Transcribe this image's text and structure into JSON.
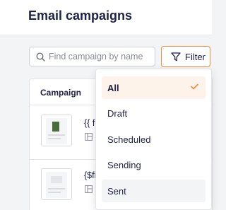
{
  "page": {
    "title": "Email campaigns"
  },
  "search": {
    "placeholder": "Find campaign by name",
    "value": ""
  },
  "filter": {
    "label": "Filter"
  },
  "table": {
    "column_header": "Campaign",
    "rows": [
      {
        "name": "{{ fi"
      },
      {
        "name": "{$fi"
      }
    ]
  },
  "filter_menu": {
    "items": [
      {
        "label": "All",
        "selected": true
      },
      {
        "label": "Draft",
        "selected": false
      },
      {
        "label": "Scheduled",
        "selected": false
      },
      {
        "label": "Sending",
        "selected": false
      },
      {
        "label": "Sent",
        "selected": false
      }
    ]
  },
  "colors": {
    "accent": "#f08a3c",
    "text": "#1f2147",
    "selected_bg": "#fdf3ea"
  },
  "icons": {
    "search": "search-icon",
    "filter": "filter-funnel-icon",
    "check": "check-icon",
    "template": "template-layout-icon"
  }
}
